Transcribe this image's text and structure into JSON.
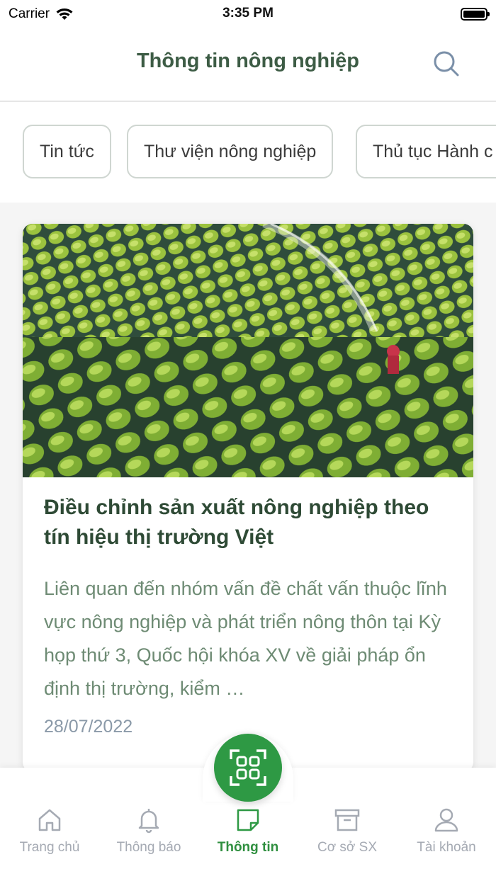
{
  "status_bar": {
    "carrier": "Carrier",
    "time": "3:35 PM"
  },
  "header": {
    "title": "Thông tin nông nghiệp",
    "search_icon": "search-icon"
  },
  "tabs": [
    {
      "label": "Tin tức"
    },
    {
      "label": "Thư viện nông nghiệp"
    },
    {
      "label": "Thủ tục Hành c"
    }
  ],
  "article": {
    "title": "Điều chỉnh sản xuất nông nghiệp theo tín hiệu thị trường Việt",
    "summary": "Liên quan đến nhóm vấn đề chất vấn thuộc lĩnh vực nông nghiệp và phát triển nông thôn tại Kỳ họp thứ 3, Quốc hội khóa XV về giải pháp ổn định thị trường, kiểm …",
    "date": "28/07/2022"
  },
  "bottom_nav": [
    {
      "label": "Trang chủ",
      "icon": "home-icon",
      "active": false
    },
    {
      "label": "Thông báo",
      "icon": "bell-icon",
      "active": false
    },
    {
      "label": "Thông tin",
      "icon": "note-icon",
      "active": true
    },
    {
      "label": "Cơ sở SX",
      "icon": "archive-box-icon",
      "active": false
    },
    {
      "label": "Tài khoản",
      "icon": "user-icon",
      "active": false
    }
  ],
  "colors": {
    "primary_green": "#2e9944",
    "title_green": "#3d5c45",
    "inactive_gray": "#a5aab3"
  }
}
